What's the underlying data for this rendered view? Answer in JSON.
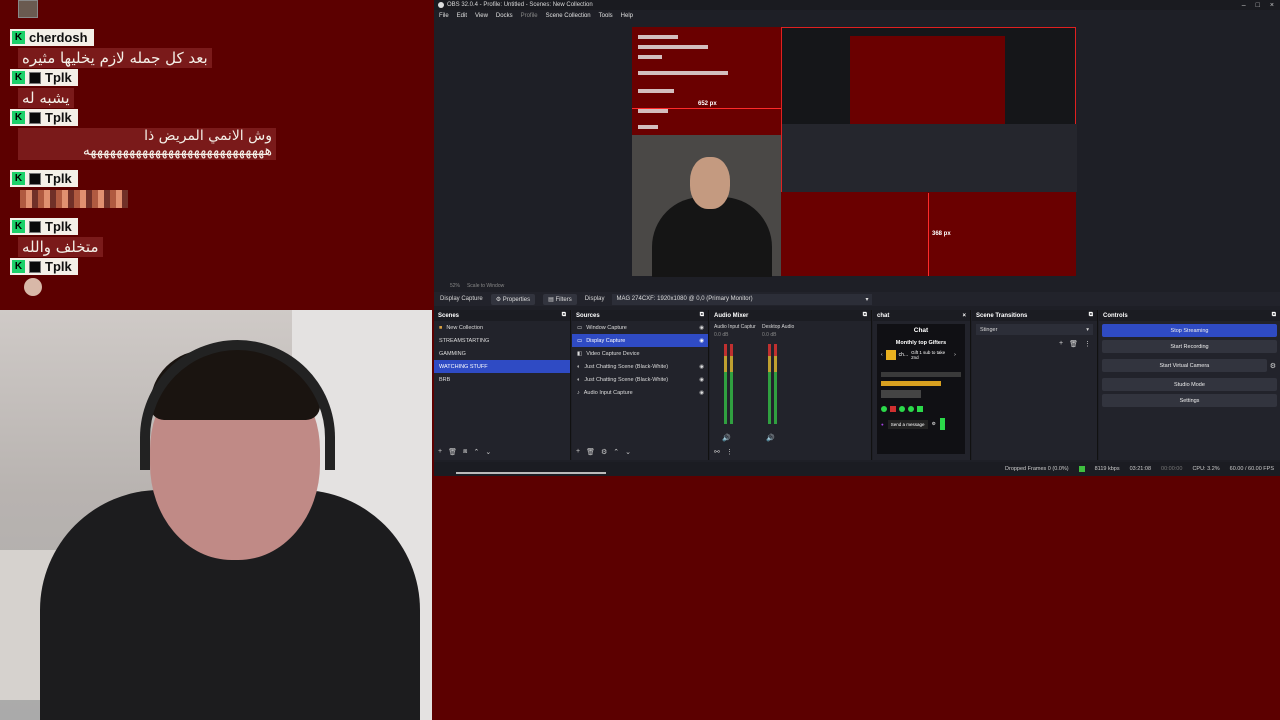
{
  "overlay_chat": {
    "messages": [
      {
        "user": "cherdosh",
        "text": "بعد كل جمله لازم يخليها مثيره"
      },
      {
        "user": "Tplk",
        "text": "يشبه له"
      },
      {
        "user": "Tplk",
        "text": "وش الانمي المريض ذا ههههههههههههههههههههههههههههه"
      },
      {
        "user": "Tplk",
        "text": ""
      },
      {
        "user": "Tplk",
        "text": "متخلف والله"
      },
      {
        "user": "Tplk",
        "text": ""
      }
    ]
  },
  "obs": {
    "title": "OBS 32.0.4 - Profile: Untitled - Scenes: New Collection",
    "menu": [
      "File",
      "Edit",
      "View",
      "Docks",
      "Profile",
      "Scene Collection",
      "Tools",
      "Help"
    ],
    "preview_px_width": "652 px",
    "preview_px_height": "368 px",
    "zoom": "52%",
    "scale_label": "Scale to Window",
    "source_bar": {
      "source_name": "Display Capture",
      "properties": "Properties",
      "filters": "Filters",
      "display_label": "Display",
      "display_value": "MAG 274CXF: 1920x1080 @ 0,0 (Primary Monitor)"
    },
    "scenes": {
      "title": "Scenes",
      "items": [
        "New Collection",
        "STREAMSTARTING",
        "GAMMING",
        "WATCHING STUFF",
        "BRB"
      ],
      "active_index": 3
    },
    "sources": {
      "title": "Sources",
      "items": [
        "Window Capture",
        "Display Capture",
        "Video Capture Device",
        "Just Chatting Scene (Black-White)",
        "Just Chatting Scene (Black-White)",
        "Audio Input Capture"
      ],
      "active_index": 1
    },
    "audio_mixer": {
      "title": "Audio Mixer",
      "channels": [
        {
          "name": "Audio Input Captur",
          "db": "0.0 dB"
        },
        {
          "name": "Desktop Audio",
          "db": "0.0 dB"
        }
      ]
    },
    "chat_dock": {
      "title": "chat",
      "header": "Chat",
      "gifters_title": "Monthly top Gifters",
      "gift_text": "Gift 1 sub to take 2nd",
      "top_gifter": "ch...",
      "send_placeholder": "Send a message"
    },
    "transitions": {
      "title": "Scene Transitions",
      "value": "Stinger"
    },
    "controls": {
      "title": "Controls",
      "buttons": [
        "Stop Streaming",
        "Start Recording",
        "Start Virtual Camera",
        "Studio Mode",
        "Settings"
      ]
    },
    "status": {
      "dropped": "Dropped Frames 0 (0.0%)",
      "bitrate": "8119 kbps",
      "stream_time": "03:21:08",
      "rec_time": "00:00:00",
      "cpu": "CPU: 3.2%",
      "fps": "60.00 / 60.00 FPS"
    }
  },
  "colors": {
    "overlay_bg": "#5c0000",
    "obs_accent": "#2f4bc4",
    "chat_green": "#1cd16a"
  }
}
